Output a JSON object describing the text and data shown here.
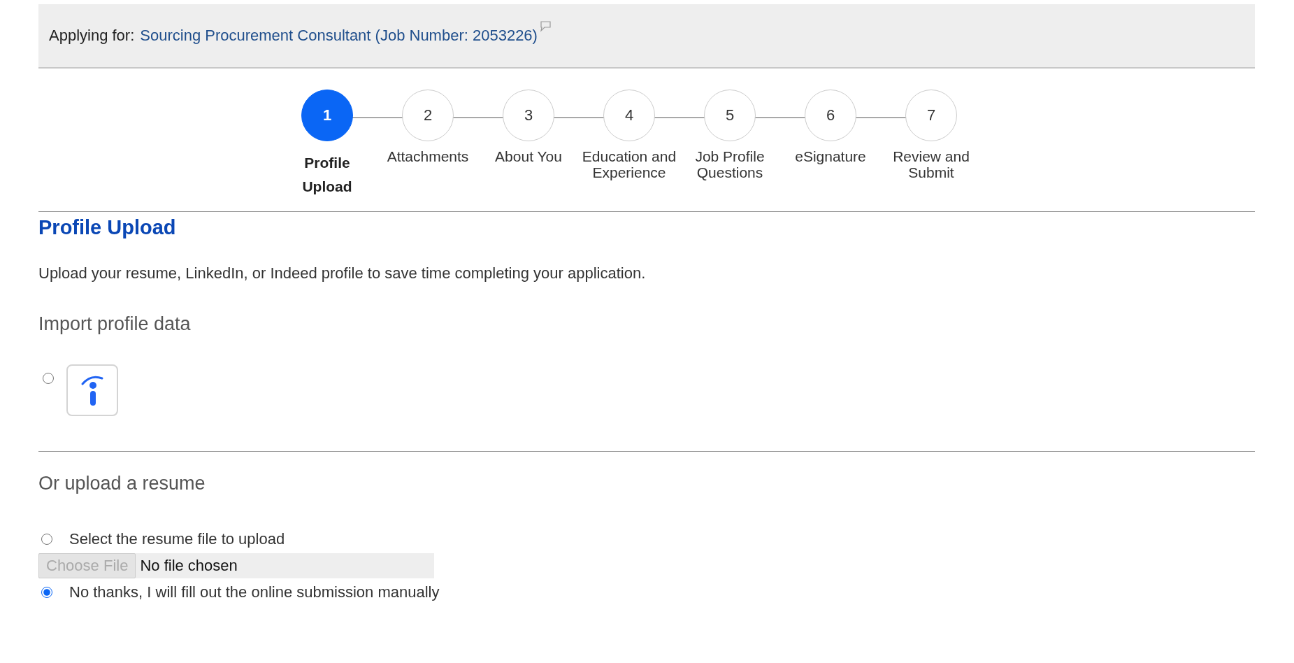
{
  "header": {
    "label": "Applying for:",
    "job_title": "Sourcing Procurement Consultant (Job Number: 2053226)"
  },
  "steps": [
    {
      "number": "1",
      "label": "Profile Upload",
      "selected": true
    },
    {
      "number": "2",
      "label": "Attachments",
      "selected": false
    },
    {
      "number": "3",
      "label": "About You",
      "selected": false
    },
    {
      "number": "4",
      "label": "Education and Experience",
      "selected": false
    },
    {
      "number": "5",
      "label": "Job Profile Questions",
      "selected": false
    },
    {
      "number": "6",
      "label": "eSignature",
      "selected": false
    },
    {
      "number": "7",
      "label": "Review and Submit",
      "selected": false
    }
  ],
  "section": {
    "title": "Profile Upload",
    "intro": "Upload your resume, LinkedIn, or Indeed profile to save time completing your application."
  },
  "import": {
    "title": "Import profile data",
    "options": [
      {
        "selected": false
      }
    ]
  },
  "upload": {
    "title": "Or upload a resume",
    "options": [
      {
        "kind": "radio",
        "label": "Select the resume file to upload",
        "selected": false
      },
      {
        "kind": "file",
        "button": "Choose File",
        "value": "No file chosen",
        "disabled": true
      },
      {
        "kind": "radio",
        "label": "No thanks, I will fill out the online submission manually",
        "selected": true
      }
    ]
  }
}
